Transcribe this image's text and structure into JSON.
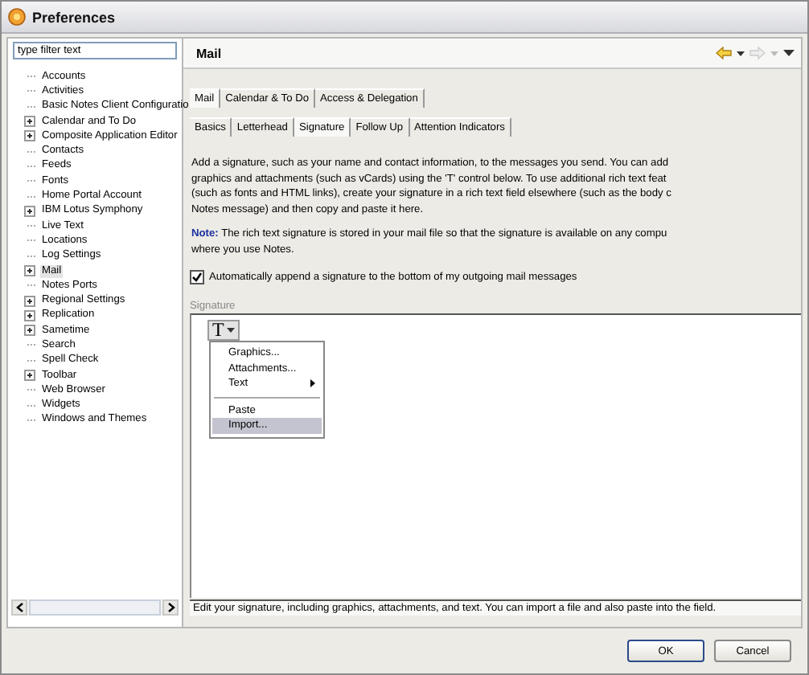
{
  "window": {
    "title": "Preferences"
  },
  "filter": {
    "placeholder": "type filter text"
  },
  "tree": [
    {
      "label": "Accounts",
      "kind": "leaf",
      "selected": false
    },
    {
      "label": "Activities",
      "kind": "leaf",
      "selected": false
    },
    {
      "label": "Basic Notes Client Configuratio",
      "kind": "leaf",
      "selected": false
    },
    {
      "label": "Calendar and To Do",
      "kind": "group",
      "selected": false
    },
    {
      "label": "Composite Application Editor",
      "kind": "group",
      "selected": false
    },
    {
      "label": "Contacts",
      "kind": "leaf",
      "selected": false
    },
    {
      "label": "Feeds",
      "kind": "leaf",
      "selected": false
    },
    {
      "label": "Fonts",
      "kind": "leaf",
      "selected": false
    },
    {
      "label": "Home Portal Account",
      "kind": "leaf",
      "selected": false
    },
    {
      "label": "IBM Lotus Symphony",
      "kind": "group",
      "selected": false
    },
    {
      "label": "Live Text",
      "kind": "leaf",
      "selected": false
    },
    {
      "label": "Locations",
      "kind": "leaf",
      "selected": false
    },
    {
      "label": "Log Settings",
      "kind": "leaf",
      "selected": false
    },
    {
      "label": "Mail",
      "kind": "group",
      "selected": true
    },
    {
      "label": "Notes Ports",
      "kind": "leaf",
      "selected": false
    },
    {
      "label": "Regional Settings",
      "kind": "group",
      "selected": false
    },
    {
      "label": "Replication",
      "kind": "group",
      "selected": false
    },
    {
      "label": "Sametime",
      "kind": "group",
      "selected": false
    },
    {
      "label": "Search",
      "kind": "leaf",
      "selected": false
    },
    {
      "label": "Spell Check",
      "kind": "leaf",
      "selected": false
    },
    {
      "label": "Toolbar",
      "kind": "group",
      "selected": false
    },
    {
      "label": "Web Browser",
      "kind": "leaf",
      "selected": false
    },
    {
      "label": "Widgets",
      "kind": "leaf",
      "selected": false
    },
    {
      "label": "Windows and Themes",
      "kind": "leaf",
      "selected": false
    }
  ],
  "page": {
    "title": "Mail",
    "tabs": [
      {
        "label": "Mail",
        "selected": true
      },
      {
        "label": "Calendar & To Do",
        "selected": false
      },
      {
        "label": "Access & Delegation",
        "selected": false
      }
    ],
    "subtabs": [
      {
        "label": "Basics",
        "selected": false
      },
      {
        "label": "Letterhead",
        "selected": false
      },
      {
        "label": "Signature",
        "selected": true
      },
      {
        "label": "Follow Up",
        "selected": false
      },
      {
        "label": "Attention Indicators",
        "selected": false
      }
    ],
    "description": [
      "Add a signature, such as your name and contact information, to the messages you send.  You can add",
      "graphics and attachments (such as vCards) using the 'T' control below.  To use additional rich text feat",
      "(such as fonts and HTML links), create your signature in a rich text field elsewhere (such as the body c",
      "Notes message) and then copy and paste it here."
    ],
    "note": [
      "**Note:**  The rich text signature is stored in your mail file so that the signature is available on any compu",
      "where you use Notes."
    ],
    "auto_append": {
      "label": "Automatically append a signature to the bottom of my outgoing mail messages",
      "checked": true
    },
    "signature": {
      "label": "Signature",
      "button": "T",
      "menu": [
        {
          "kind": "item",
          "label": "Graphics...",
          "selected": false
        },
        {
          "kind": "item",
          "label": "Attachments...",
          "selected": false
        },
        {
          "kind": "submenu",
          "label": "Text",
          "selected": false
        },
        {
          "kind": "separator"
        },
        {
          "kind": "item",
          "label": "Paste",
          "selected": false
        },
        {
          "kind": "item",
          "label": "Import...",
          "selected": true
        }
      ]
    },
    "hint": "Edit your signature, including graphics, attachments, and text.  You can import a file and also paste into the field."
  },
  "buttons": [
    "OK",
    "Cancel"
  ]
}
